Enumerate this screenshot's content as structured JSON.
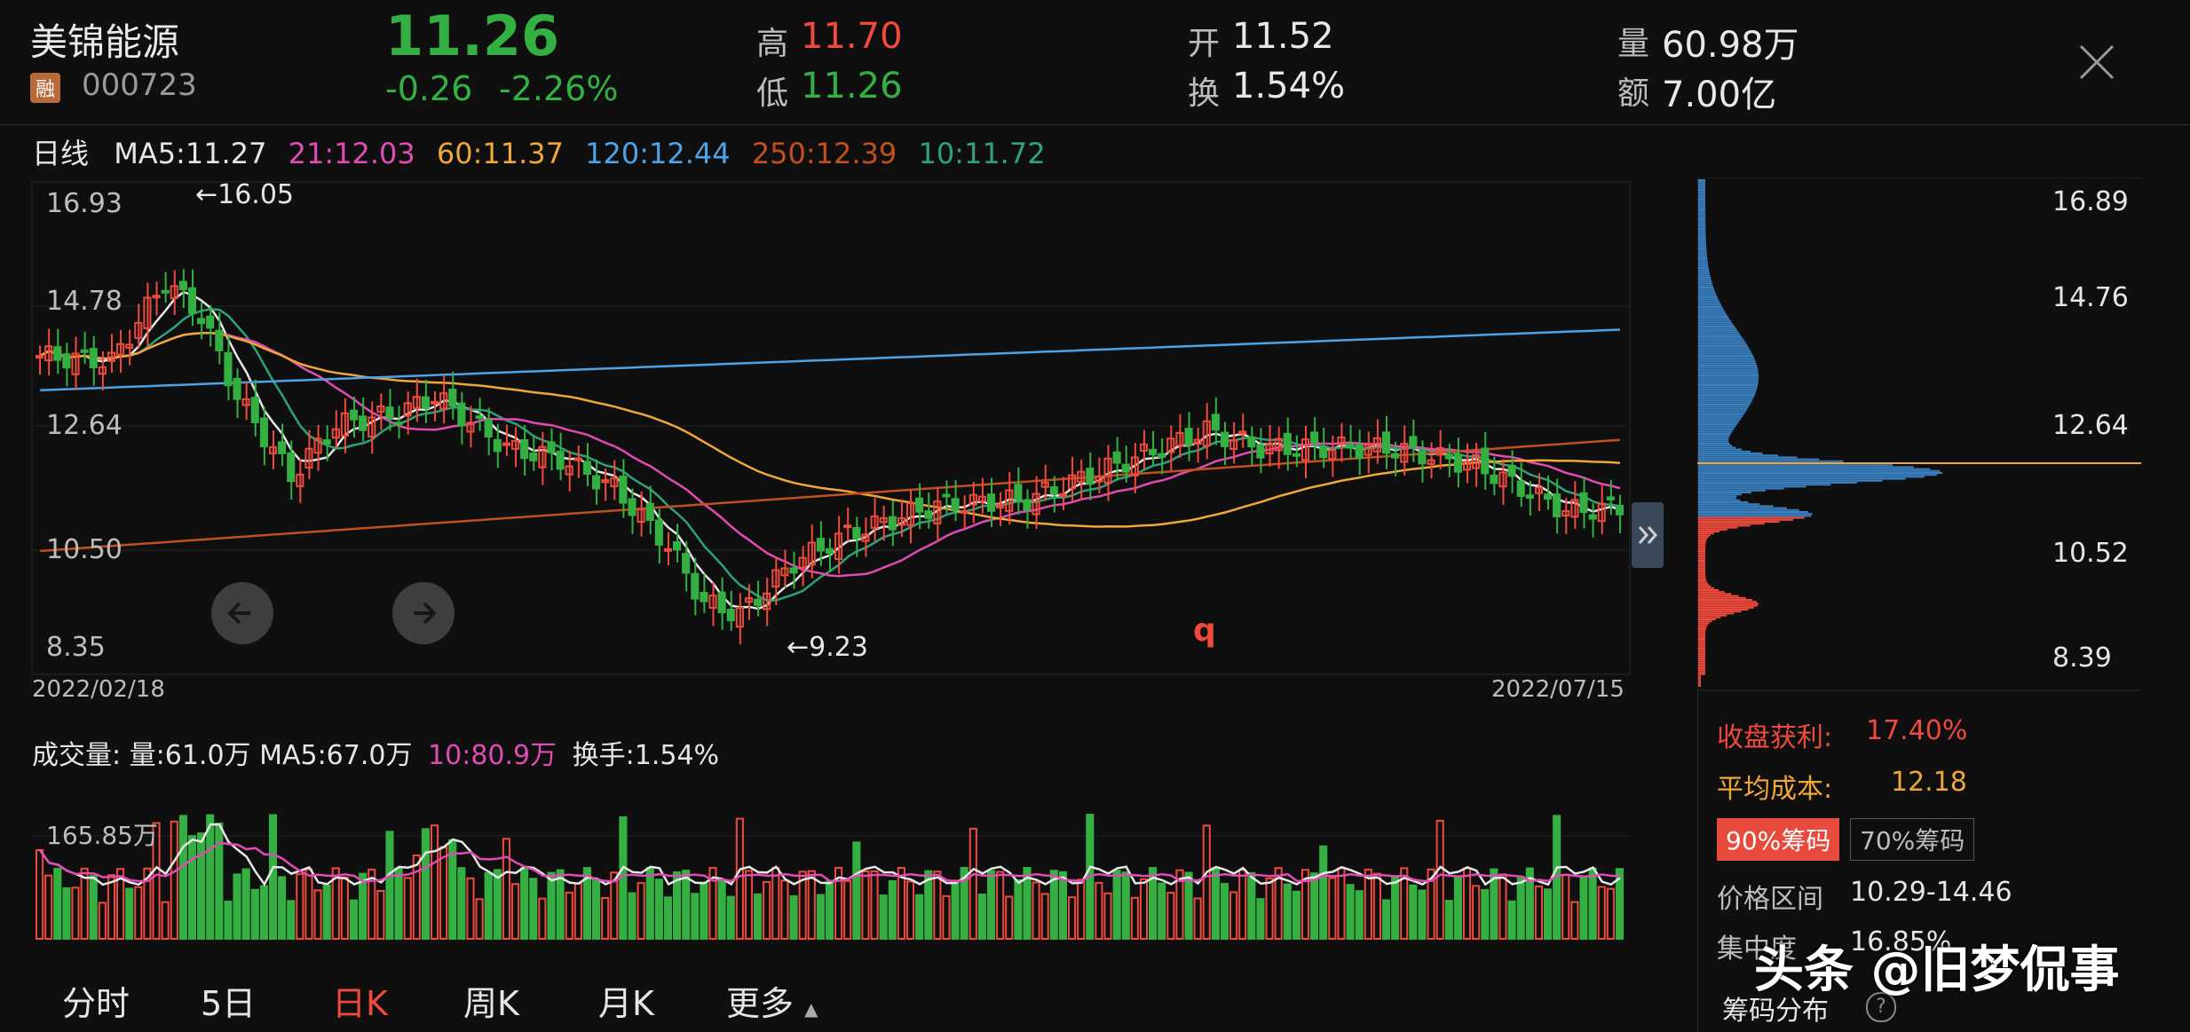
{
  "stock": {
    "name": "美锦能源",
    "tag": "融",
    "code": "000723",
    "price": "11.26",
    "change": "-0.26",
    "change_pct": "-2.26%"
  },
  "quote": {
    "high_label": "高",
    "high": "11.70",
    "low_label": "低",
    "low": "11.26",
    "open_label": "开",
    "open": "11.52",
    "turnover_label": "换",
    "turnover": "1.54%",
    "volume_label": "量",
    "volume": "60.98万",
    "amount_label": "额",
    "amount": "7.00亿"
  },
  "ma_legend": {
    "period": "日线",
    "items": [
      {
        "text": "MA5:11.27",
        "color": "#e6e6e6"
      },
      {
        "text": "21:12.03",
        "color": "#e04bb4"
      },
      {
        "text": "60:11.37",
        "color": "#f0a73a"
      },
      {
        "text": "120:12.44",
        "color": "#4ea3e6"
      },
      {
        "text": "250:12.39",
        "color": "#c0501e"
      },
      {
        "text": "10:11.72",
        "color": "#2fa27a"
      }
    ]
  },
  "main_chart": {
    "y_ticks": [
      "16.93",
      "14.78",
      "12.64",
      "10.50",
      "8.35"
    ],
    "y_range": [
      8.35,
      16.93
    ],
    "max_annotation": "←16.05",
    "min_annotation": "←9.23",
    "start_date": "2022/02/18",
    "end_date": "2022/07/15",
    "marker_q": "q",
    "up_color": "#f04a3c",
    "down_color": "#34b043"
  },
  "chip_panel": {
    "y_ticks": [
      "16.89",
      "14.76",
      "12.64",
      "10.52",
      "8.39"
    ],
    "profit_label": "收盘获利:",
    "profit_value": "17.40%",
    "avg_cost_label": "平均成本:",
    "avg_cost_value": "12.18",
    "btn_90": "90%筹码",
    "btn_70": "70%筹码",
    "price_range_label": "价格区间",
    "price_range_value": "10.29-14.46",
    "concentration_label": "集中度",
    "concentration_value": "16.85%",
    "title": "筹码分布"
  },
  "volume_panel": {
    "label": "成交量: 量:61.0万 MA5:67.0万",
    "ma10": "10:80.9万",
    "turnover": "换手:1.54%",
    "tick": "165.85万"
  },
  "tabs": [
    {
      "label": "分时",
      "active": false
    },
    {
      "label": "5日",
      "active": false
    },
    {
      "label": "日K",
      "active": true
    },
    {
      "label": "周K",
      "active": false
    },
    {
      "label": "月K",
      "active": false
    },
    {
      "label": "更多",
      "active": false
    }
  ],
  "watermark": "头条 @旧梦侃事"
}
